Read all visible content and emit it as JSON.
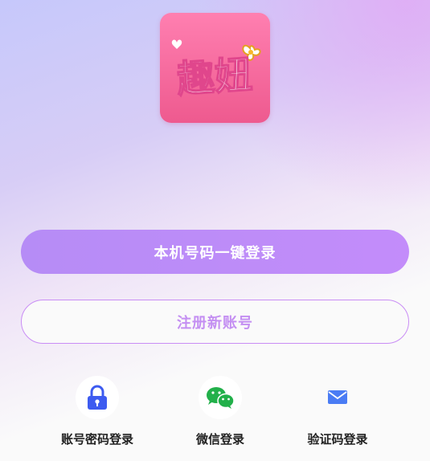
{
  "logo": {
    "text": "趣妞"
  },
  "buttons": {
    "one_click_login": "本机号码一键登录",
    "register": "注册新账号"
  },
  "login_options": [
    {
      "label": "账号密码登录",
      "icon": "lock-icon",
      "color": "#3d5bf0"
    },
    {
      "label": "微信登录",
      "icon": "wechat-icon",
      "color": "#22b04a"
    },
    {
      "label": "验证码登录",
      "icon": "mail-icon",
      "color": "#4a7cf4"
    }
  ]
}
